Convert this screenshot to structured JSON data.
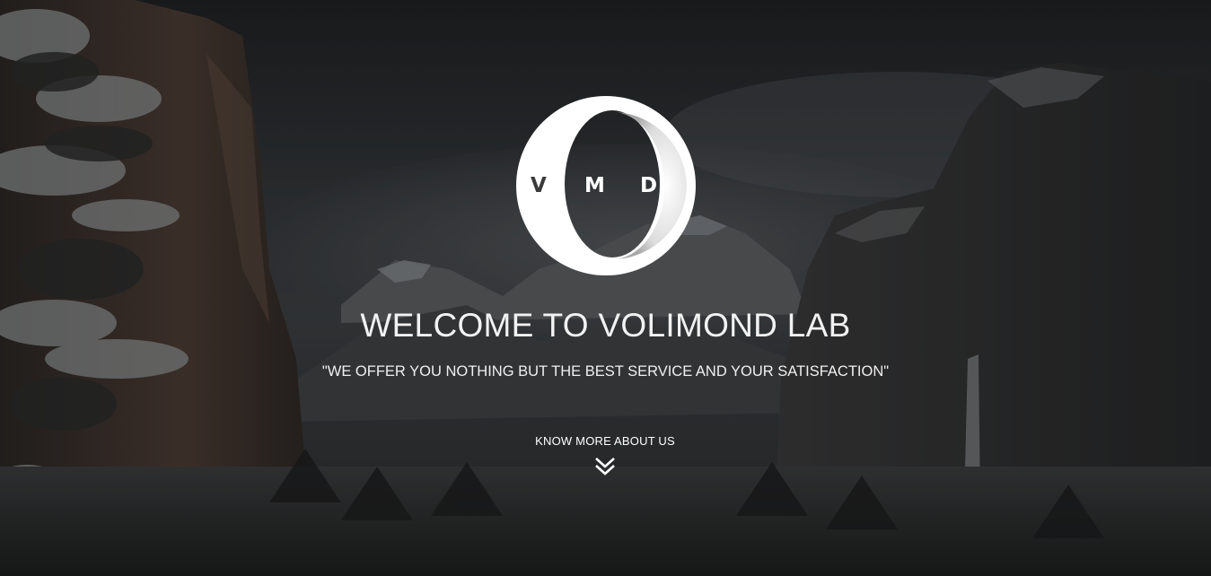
{
  "hero": {
    "logo": {
      "letters": [
        "V",
        "M",
        "D"
      ],
      "icon": "crescent-ring-logo"
    },
    "title": "WELCOME TO VOLIMOND LAB",
    "tagline": "\"WE OFFER YOU NOTHING BUT THE BEST SERVICE AND YOUR SATISFACTION\"",
    "cta": {
      "label": "KNOW MORE ABOUT US",
      "icon": "double-chevron-down-icon"
    },
    "background_icon": "mountain-valley-background"
  },
  "colors": {
    "text": "#ffffff",
    "overlay": "#1d1f21",
    "logo_ring": "#ffffff"
  }
}
